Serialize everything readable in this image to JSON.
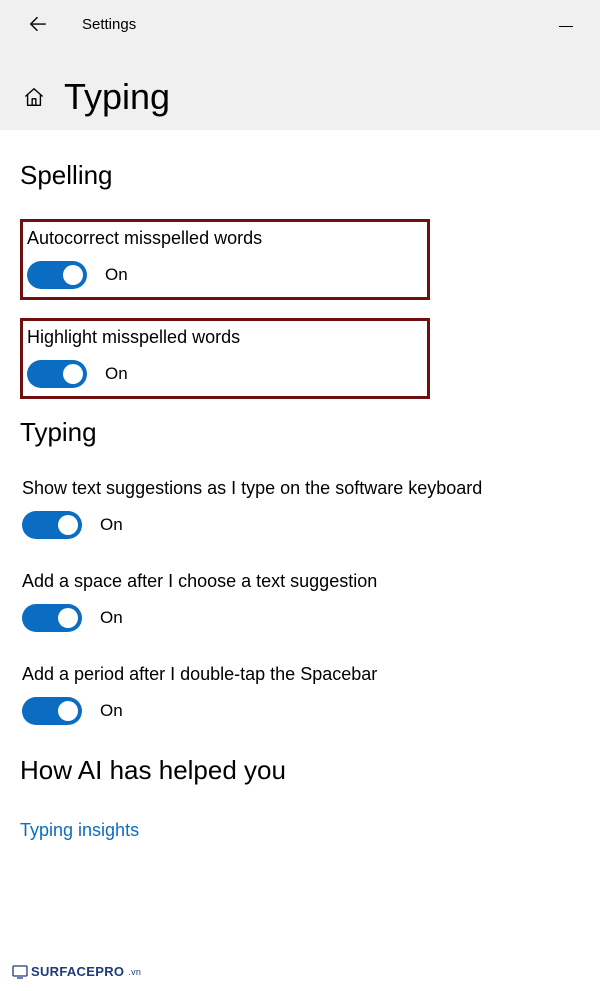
{
  "app_title": "Settings",
  "page_title": "Typing",
  "sections": {
    "spelling": {
      "title": "Spelling",
      "autocorrect": {
        "label": "Autocorrect misspelled words",
        "state": "On"
      },
      "highlight": {
        "label": "Highlight misspelled words",
        "state": "On"
      }
    },
    "typing": {
      "title": "Typing",
      "suggestions": {
        "label": "Show text suggestions as I type on the software keyboard",
        "state": "On"
      },
      "add_space": {
        "label": "Add a space after I choose a text suggestion",
        "state": "On"
      },
      "add_period": {
        "label": "Add a period after I double-tap the Spacebar",
        "state": "On"
      }
    },
    "ai": {
      "title": "How AI has helped you",
      "link": "Typing insights"
    }
  },
  "watermark": {
    "brand": "SURFACEPRO",
    "suffix": ".vn"
  }
}
